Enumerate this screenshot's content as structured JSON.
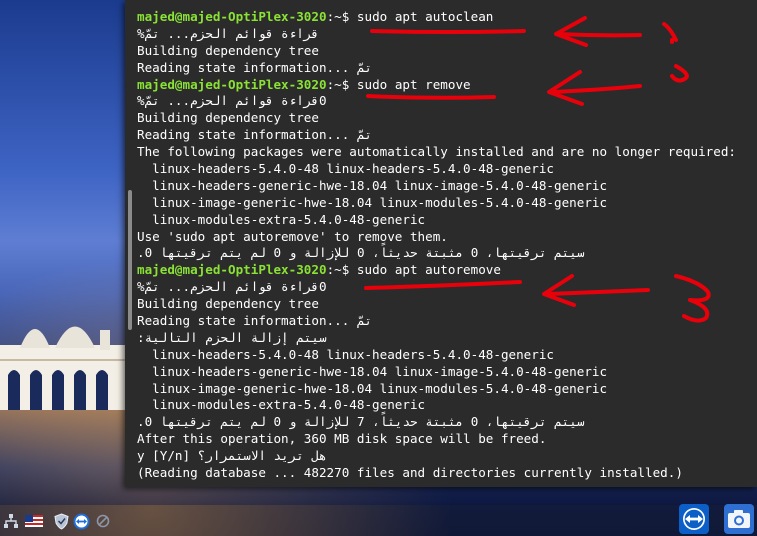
{
  "terminal": {
    "lines": [
      {
        "prompt": "majed@majed-OptiPlex-3020",
        "suffix": ":~$ ",
        "text": "sudo apt autoclean"
      },
      {
        "text": "قراءة قوائم الحزم... تمّ%",
        "rtl": true
      },
      {
        "text": "Building dependency tree"
      },
      {
        "text": "Reading state information... تمّ"
      },
      {
        "prompt": "majed@majed-OptiPlex-3020",
        "suffix": ":~$ ",
        "text": "sudo apt remove"
      },
      {
        "text": "0قراءة قوائم الحزم... تمّ%",
        "rtl": true
      },
      {
        "text": "Building dependency tree"
      },
      {
        "text": "Reading state information... تمّ"
      },
      {
        "text": "The following packages were automatically installed and are no longer required:"
      },
      {
        "text": "  linux-headers-5.4.0-48 linux-headers-5.4.0-48-generic"
      },
      {
        "text": "  linux-headers-generic-hwe-18.04 linux-image-5.4.0-48-generic"
      },
      {
        "text": "  linux-image-generic-hwe-18.04 linux-modules-5.4.0-48-generic"
      },
      {
        "text": "  linux-modules-extra-5.4.0-48-generic"
      },
      {
        "text": "Use 'sudo apt autoremove' to remove them."
      },
      {
        "text": "سيتم ترقيتها، 0 مثبتة حديثاً، 0 للإزالة و 0 لم يتم ترقيتها 0.",
        "rtl": true
      },
      {
        "prompt": "majed@majed-OptiPlex-3020",
        "suffix": ":~$ ",
        "text": "sudo apt autoremove"
      },
      {
        "text": "0قراءة قوائم الحزم... تمّ%",
        "rtl": true
      },
      {
        "text": "Building dependency tree"
      },
      {
        "text": "Reading state information... تمّ"
      },
      {
        "text": "سيتم إزالة الحزم التالية:",
        "rtl": true
      },
      {
        "text": "  linux-headers-5.4.0-48 linux-headers-5.4.0-48-generic"
      },
      {
        "text": "  linux-headers-generic-hwe-18.04 linux-image-5.4.0-48-generic"
      },
      {
        "text": "  linux-image-generic-hwe-18.04 linux-modules-5.4.0-48-generic"
      },
      {
        "text": "  linux-modules-extra-5.4.0-48-generic"
      },
      {
        "text": "سيتم ترقيتها، 0 مثبتة حديثاً، 7 للإزالة و 0 لم يتم ترقيتها 0.",
        "rtl": true
      },
      {
        "text": "After this operation, 360 MB disk space will be freed."
      },
      {
        "text": "هل تريد الاستمرار؟ [Y/n] y",
        "rtl": true
      },
      {
        "text": "(Reading database ... 482270 files and directories currently installed.)"
      }
    ]
  },
  "annotations": {
    "color": "#e8000b",
    "labels": [
      "1",
      "2",
      "3"
    ]
  },
  "taskbar": {
    "icons": [
      "network-icon",
      "us-flag-icon",
      "shield-icon",
      "teamviewer-icon",
      "blocked-icon"
    ],
    "apps": [
      "teamviewer-app-icon",
      "screenshot-camera-icon"
    ]
  },
  "colors": {
    "prompt": "#8ae234",
    "terminal_bg": "#2b2b2b",
    "text": "#ffffff"
  }
}
